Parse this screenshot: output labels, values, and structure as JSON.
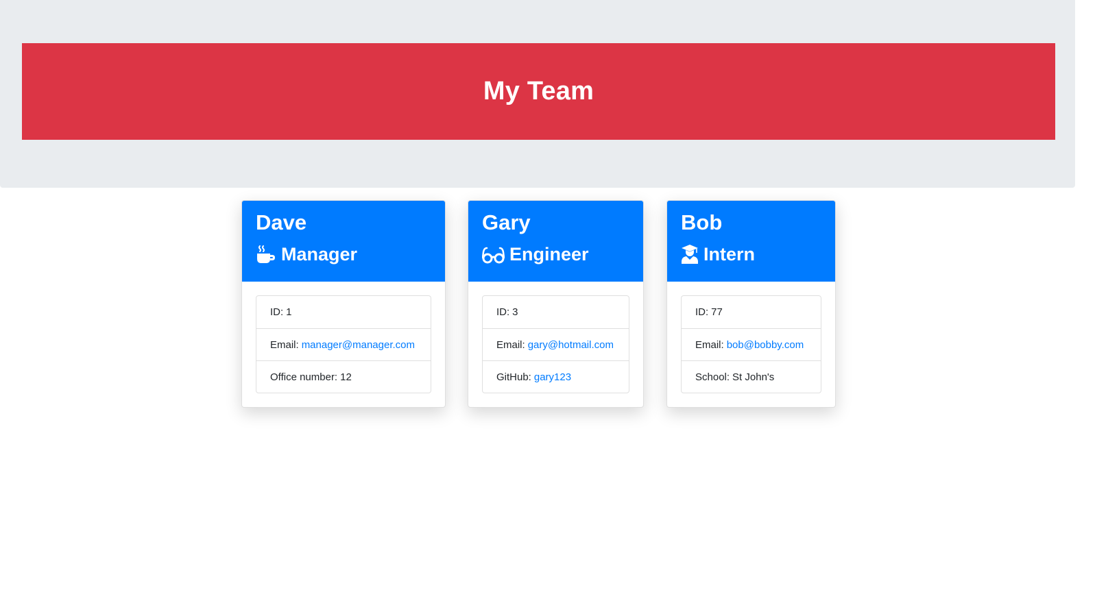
{
  "header": {
    "title": "My Team"
  },
  "colors": {
    "banner": "#dc3545",
    "card_header": "#007bff",
    "link": "#007bff",
    "jumbotron": "#e9ecef"
  },
  "cards": [
    {
      "name": "Dave",
      "role": "Manager",
      "icon": "mug-icon",
      "id_label": "ID:",
      "id_value": "1",
      "email_label": "Email:",
      "email_value": "manager@manager.com",
      "extra_label": "Office number:",
      "extra_value": "12"
    },
    {
      "name": "Gary",
      "role": "Engineer",
      "icon": "glasses-icon",
      "id_label": "ID:",
      "id_value": "3",
      "email_label": "Email:",
      "email_value": "gary@hotmail.com",
      "extra_label": "GitHub:",
      "extra_value": "gary123"
    },
    {
      "name": "Bob",
      "role": "Intern",
      "icon": "graduate-icon",
      "id_label": "ID:",
      "id_value": "77",
      "email_label": "Email:",
      "email_value": "bob@bobby.com",
      "extra_label": "School:",
      "extra_value": "St John's"
    }
  ]
}
